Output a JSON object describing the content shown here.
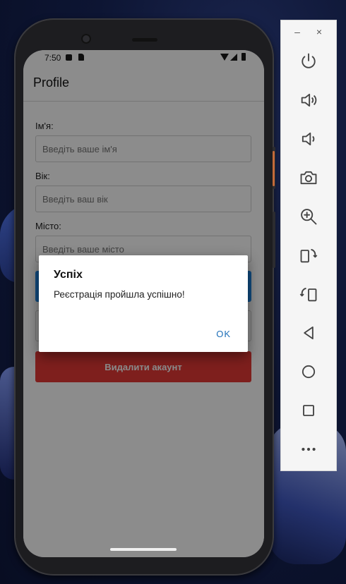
{
  "status_bar": {
    "time": "7:50"
  },
  "app": {
    "title": "Profile"
  },
  "form": {
    "name_label": "Ім'я:",
    "name_placeholder": "Введіть ваше ім'я",
    "age_label": "Вік:",
    "age_placeholder": "Введіть ваш вік",
    "city_label": "Місто:",
    "city_placeholder": "Введіть ваше місто",
    "delete_button": "Видалити акаунт"
  },
  "dialog": {
    "title": "Успіх",
    "message": "Реєстрація пройшла успішно!",
    "ok_label": "OK"
  },
  "toolbar": {
    "minimize_label": "–",
    "close_label": "×",
    "buttons": [
      "power-icon",
      "volume-up-icon",
      "volume-down-icon",
      "camera-icon",
      "zoom-icon",
      "rotate-left-icon",
      "rotate-right-icon",
      "back-icon",
      "home-icon",
      "overview-icon",
      "more-icon"
    ]
  },
  "colors": {
    "primary": "#1e88e5",
    "danger": "#e53935",
    "dialog_button": "#1e6fb8"
  }
}
